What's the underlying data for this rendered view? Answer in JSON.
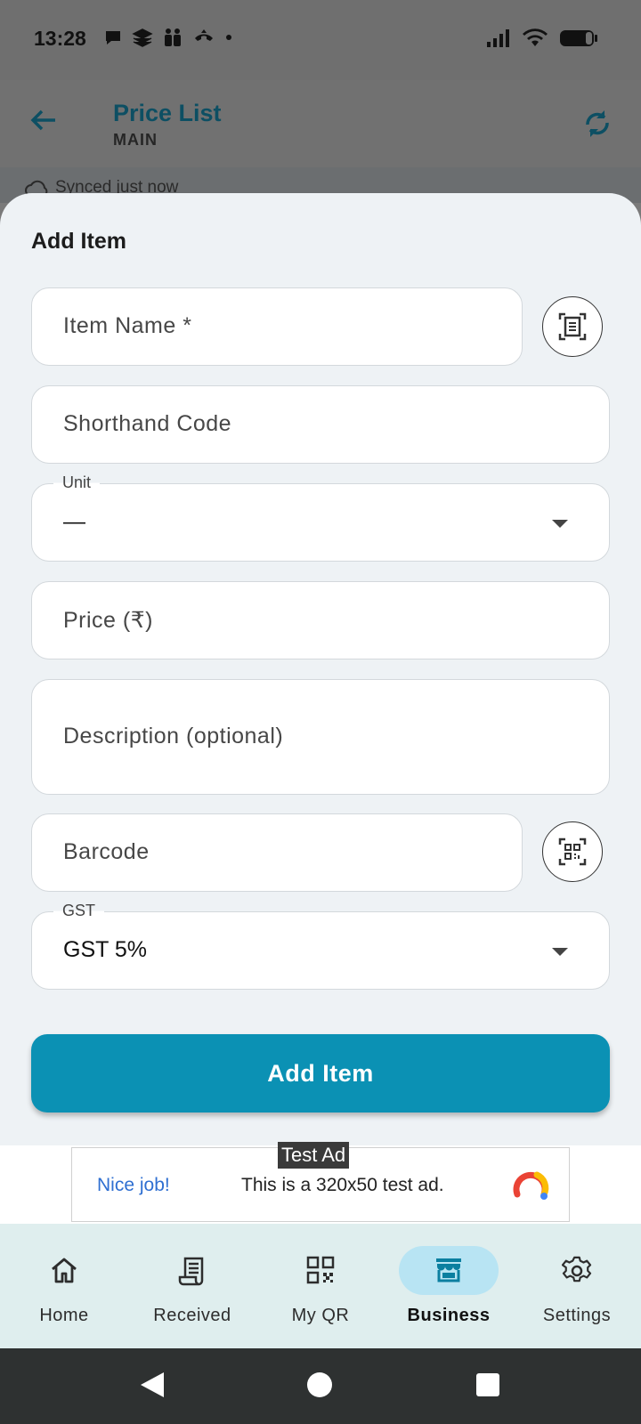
{
  "status_bar": {
    "time": "13:28",
    "left_icons": [
      "chat-bubble-icon",
      "stacked-layers-icon",
      "people-icon",
      "phone-hangup-icon",
      "dot-icon"
    ],
    "right_icons": [
      "signal-icon",
      "wifi-icon",
      "battery-icon"
    ]
  },
  "app_bar": {
    "title": "Price List",
    "subtitle": "MAIN"
  },
  "sync": {
    "text": "Synced just now"
  },
  "sheet": {
    "title": "Add Item",
    "fields": {
      "item_name": {
        "placeholder": "Item Name *"
      },
      "shorthand": {
        "placeholder": "Shorthand Code"
      },
      "unit": {
        "label": "Unit",
        "value": "—"
      },
      "price": {
        "placeholder": "Price (₹)"
      },
      "description": {
        "placeholder": "Description (optional)"
      },
      "barcode": {
        "placeholder": "Barcode"
      },
      "gst": {
        "label": "GST",
        "value": "GST 5%"
      }
    },
    "submit_label": "Add Item"
  },
  "ad": {
    "tag": "Test Ad",
    "headline": "Nice job!",
    "body": "This is a 320x50 test ad."
  },
  "bottom_nav": {
    "items": [
      {
        "label": "Home",
        "icon": "home-icon",
        "active": false
      },
      {
        "label": "Received",
        "icon": "receipt-icon",
        "active": false
      },
      {
        "label": "My QR",
        "icon": "qr-code-icon",
        "active": false
      },
      {
        "label": "Business",
        "icon": "store-icon",
        "active": true
      },
      {
        "label": "Settings",
        "icon": "gear-icon",
        "active": false
      }
    ]
  },
  "colors": {
    "accent": "#0b91b4",
    "nav_active_pill": "#b8e4f3",
    "sheet_bg": "#eef2f5",
    "nav_bg": "#dfeeee"
  }
}
